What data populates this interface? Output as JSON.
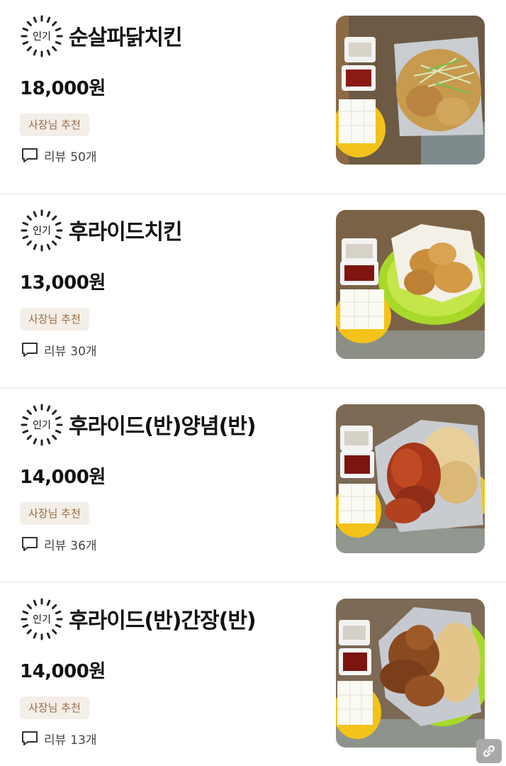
{
  "colors": {
    "tag_bg": "#f4eee8",
    "tag_text": "#9a6b44",
    "divider": "#f1f1f1",
    "share_button_bg": "#a9a9a9"
  },
  "menu": {
    "items": [
      {
        "badge_label": "인기",
        "name": "순살파닭치킨",
        "price": "18,000원",
        "tag": "사장님 추천",
        "review_label": "리뷰",
        "review_count": "50개",
        "photo": "boneless-chicken-with-green-onion-photo"
      },
      {
        "badge_label": "인기",
        "name": "후라이드치킨",
        "price": "13,000원",
        "tag": "사장님 추천",
        "review_label": "리뷰",
        "review_count": "30개",
        "photo": "fried-chicken-on-green-plate-photo"
      },
      {
        "badge_label": "인기",
        "name": "후라이드(반)양념(반)",
        "price": "14,000원",
        "tag": "사장님 추천",
        "review_label": "리뷰",
        "review_count": "36개",
        "photo": "half-fried-half-seasoned-chicken-photo"
      },
      {
        "badge_label": "인기",
        "name": "후라이드(반)간장(반)",
        "price": "14,000원",
        "tag": "사장님 추천",
        "review_label": "리뷰",
        "review_count": "13개",
        "photo": "half-fried-half-soy-chicken-photo"
      }
    ]
  },
  "share_icon": "link-icon"
}
